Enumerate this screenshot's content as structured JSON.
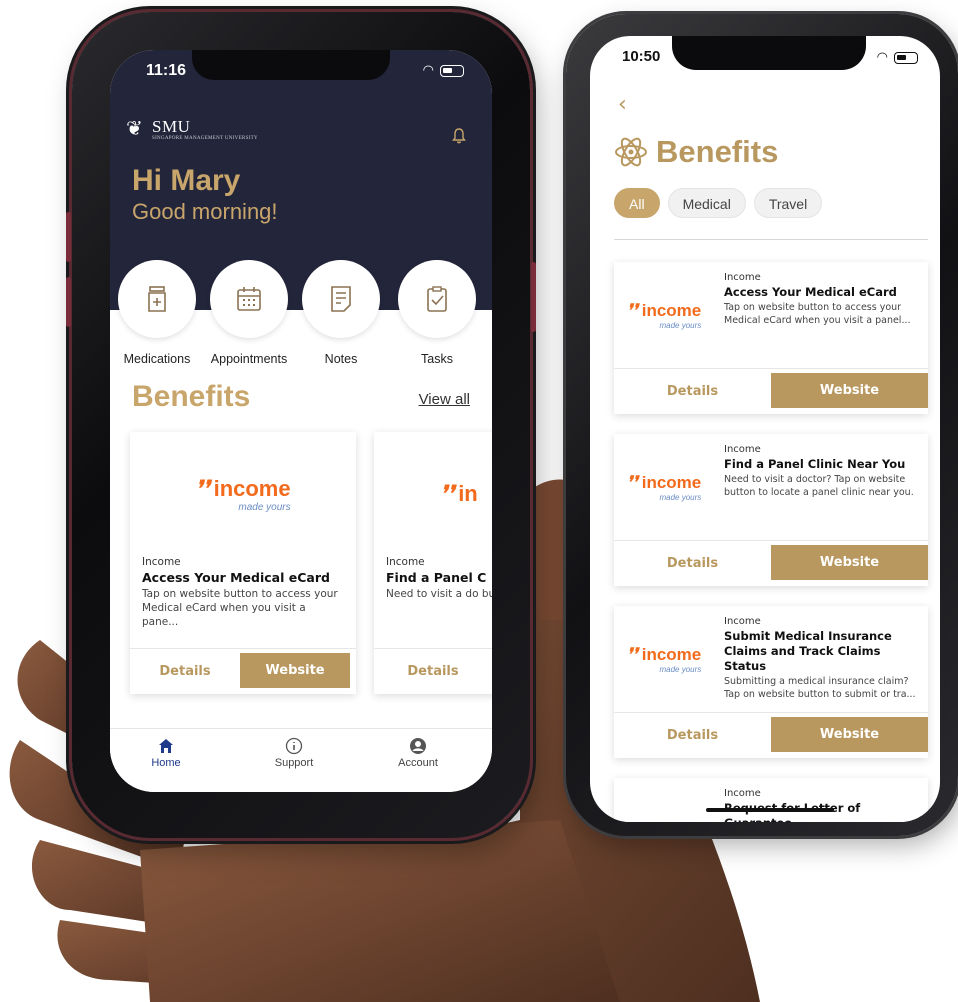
{
  "colors": {
    "gold": "#c8a56b",
    "navy": "#23263b",
    "income_orange": "#f26b1d",
    "income_blue": "#6a8dc6"
  },
  "phone1": {
    "status_time": "11:16",
    "logo_text": "SMU",
    "logo_sub": "SINGAPORE MANAGEMENT UNIVERSITY",
    "greeting": "Hi Mary",
    "subgreeting": "Good morning!",
    "quick_actions": [
      {
        "label": "Medications",
        "icon": "medication-icon"
      },
      {
        "label": "Appointments",
        "icon": "calendar-icon"
      },
      {
        "label": "Notes",
        "icon": "notes-icon"
      },
      {
        "label": "Tasks",
        "icon": "tasks-icon"
      }
    ],
    "section_title": "Benefits",
    "view_all": "View all",
    "cards": [
      {
        "logo_word": "income",
        "logo_tag": "made yours",
        "provider": "Income",
        "title": "Access Your Medical eCard",
        "desc": "Tap on website button to access your Medical eCard when you visit a pane...",
        "details": "Details",
        "website": "Website"
      },
      {
        "logo_word": "in",
        "logo_tag": "",
        "provider": "Income",
        "title": "Find a Panel C",
        "desc": "Need to visit a do button to locate a",
        "details": "Details",
        "website": ""
      }
    ],
    "tabs": [
      {
        "label": "Home",
        "icon": "home-icon"
      },
      {
        "label": "Support",
        "icon": "info-icon"
      },
      {
        "label": "Account",
        "icon": "account-icon"
      }
    ]
  },
  "phone2": {
    "status_time": "10:50",
    "back": "‹",
    "title": "Benefits",
    "filters": [
      "All",
      "Medical",
      "Travel"
    ],
    "cards": [
      {
        "provider": "Income",
        "title": "Access Your Medical eCard",
        "desc": "Tap on website button to access your Medical eCard when you visit a panel...",
        "details": "Details",
        "website": "Website"
      },
      {
        "provider": "Income",
        "title": "Find a Panel Clinic Near You",
        "desc": "Need to visit a doctor? Tap on website button to locate a panel clinic near you.",
        "details": "Details",
        "website": "Website"
      },
      {
        "provider": "Income",
        "title": "Submit Medical Insurance Claims and Track Claims Status",
        "desc": "Submitting a medical insurance claim? Tap on website button to submit or tra...",
        "details": "Details",
        "website": "Website"
      },
      {
        "provider": "Income",
        "title": "Request for Letter of Guarantee",
        "desc": "",
        "details": "",
        "website": ""
      }
    ],
    "logo_word": "income",
    "logo_tag": "made yours"
  }
}
